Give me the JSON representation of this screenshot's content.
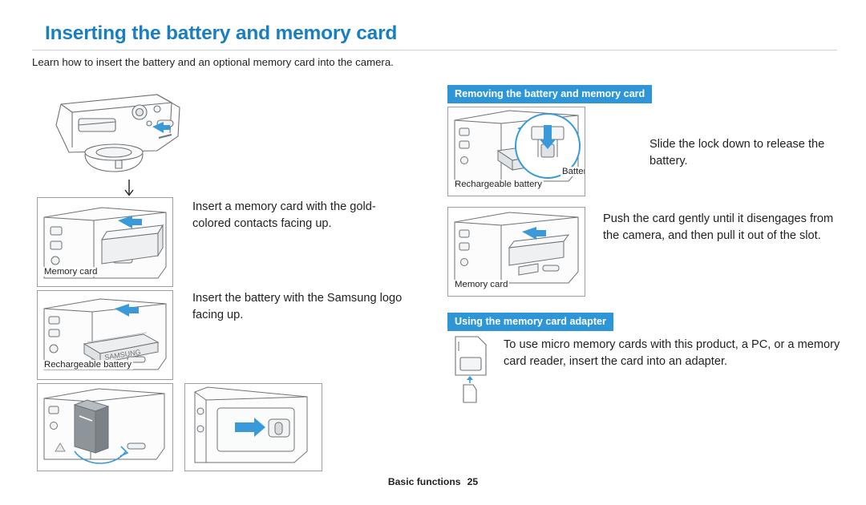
{
  "header": {
    "title": "Inserting the battery and memory card",
    "subtitle": "Learn how to insert the battery and an optional memory card into the camera."
  },
  "sections": {
    "removing": {
      "heading": "Removing the battery and memory card"
    },
    "adapter": {
      "heading": "Using the memory card adapter"
    }
  },
  "instructions": {
    "insert_card": "Insert a memory card with the gold-colored contacts facing up.",
    "insert_battery": "Insert the battery with the Samsung logo facing up.",
    "slide_lock": "Slide the lock down to release the battery.",
    "push_card": "Push the card gently until it disengages from the camera, and then pull it out of the slot.",
    "adapter_text": "To use micro memory cards with this product, a PC, or a memory card reader, insert the card into an adapter."
  },
  "captions": {
    "memory_card_left": "Memory card",
    "rechargeable_battery_left": "Rechargeable battery",
    "rechargeable_battery_right": "Rechargeable battery",
    "battery_lock": "Battery lock",
    "memory_card_right": "Memory card"
  },
  "footer": {
    "label": "Basic functions",
    "page": "25"
  },
  "icons": {
    "down_arrow": "down-arrow-icon"
  },
  "colors": {
    "title_blue": "#1a7fc1",
    "header_blue": "#2e96d6",
    "arrow_blue": "#3a9ad9",
    "line_gray": "#9aa0a5",
    "text": "#231f20"
  }
}
